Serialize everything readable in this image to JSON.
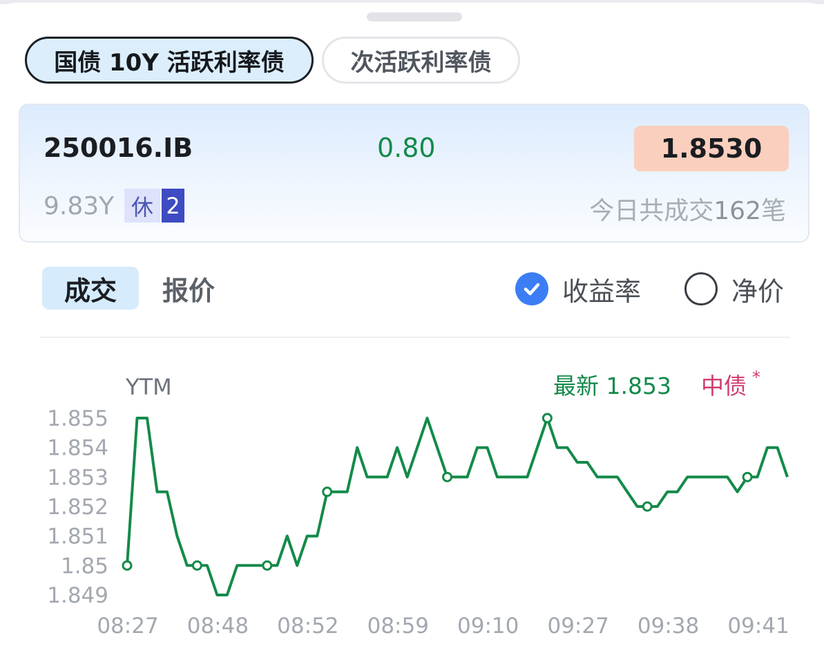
{
  "tabs": [
    {
      "label": "国债 10Y 活跃利率债",
      "active": true
    },
    {
      "label": "次活跃利率债",
      "active": false
    }
  ],
  "bond": {
    "code": "250016.IB",
    "change": "0.80",
    "price": "1.8530",
    "tenor": "9.83Y",
    "tag_rest": "休",
    "tag_num": "2",
    "trades_prefix": "今日共成交",
    "trades_count": "162",
    "trades_suffix": "笔"
  },
  "segment": {
    "deal": "成交",
    "quote": "报价"
  },
  "metric": {
    "yield": "收益率",
    "clean": "净价",
    "selected": "yield"
  },
  "colors": {
    "line": "#148a4a",
    "price_bg": "#fbcfbe",
    "accent": "#3b7df4",
    "cdc": "#d23a6b"
  },
  "icons": {
    "check": "check-icon",
    "radio": "radio-empty-icon"
  },
  "chart": {
    "ylabel": "YTM",
    "latest_label": "最新",
    "latest_value": "1.853",
    "cdc_label": "中债",
    "cdc_mark": "*"
  },
  "chart_data": {
    "type": "line",
    "ylabel": "YTM",
    "ylim": [
      1.849,
      1.855
    ],
    "yticks": [
      "1.855",
      "1.854",
      "1.853",
      "1.852",
      "1.851",
      "1.85",
      "1.849"
    ],
    "xticks": [
      "08:27",
      "08:48",
      "08:52",
      "08:59",
      "09:10",
      "09:27",
      "09:38",
      "09:41"
    ],
    "series": [
      {
        "color": "#148a4a",
        "values": [
          1.85,
          1.855,
          1.855,
          1.8525,
          1.8525,
          1.851,
          1.85,
          1.85,
          1.85,
          1.849,
          1.849,
          1.85,
          1.85,
          1.85,
          1.85,
          1.85,
          1.851,
          1.85,
          1.851,
          1.851,
          1.8525,
          1.8525,
          1.8525,
          1.854,
          1.853,
          1.853,
          1.853,
          1.854,
          1.853,
          1.854,
          1.855,
          1.854,
          1.853,
          1.853,
          1.853,
          1.854,
          1.854,
          1.853,
          1.853,
          1.853,
          1.853,
          1.854,
          1.855,
          1.854,
          1.854,
          1.8535,
          1.8535,
          1.853,
          1.853,
          1.853,
          1.8525,
          1.852,
          1.852,
          1.852,
          1.8525,
          1.8525,
          1.853,
          1.853,
          1.853,
          1.853,
          1.853,
          1.8525,
          1.853,
          1.853,
          1.854,
          1.854,
          1.853
        ]
      }
    ],
    "markers": [
      0,
      7,
      14,
      20,
      32,
      42,
      52,
      62
    ],
    "grid": false,
    "legend": "none"
  }
}
